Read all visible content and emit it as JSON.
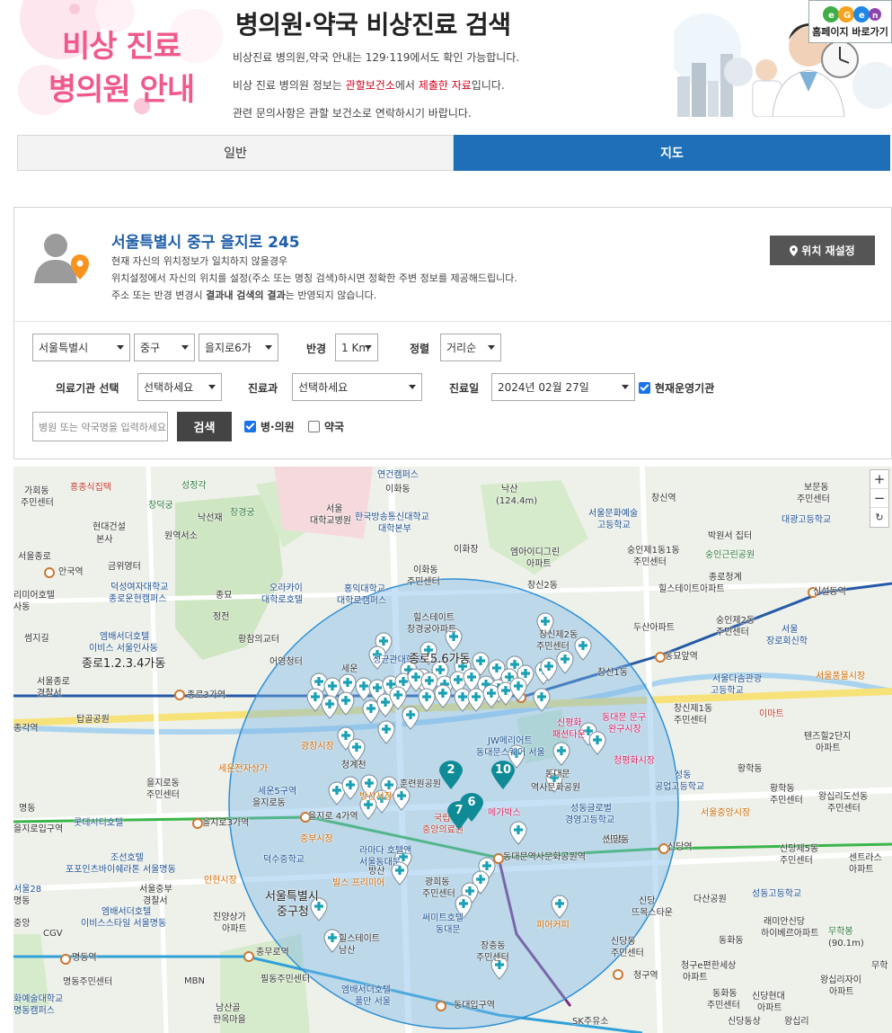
{
  "header": {
    "hero_line1": "비상 진료",
    "hero_line2": "병의원 안내",
    "title": "병의원·약국 비상진료 검색",
    "desc1": "비상진료 병의원,약국 안내는 129·119에서도 확인 가능합니다.",
    "desc2_pre": "비상 진료 병의원 정보는 ",
    "desc2_red1": "관할보건소",
    "desc2_mid": "에서 ",
    "desc2_red2": "제출한 자료",
    "desc2_post": "입니다.",
    "desc3": "관련 문의사항은 관할 보건소로 연락하시기 바랍니다.",
    "home_button": "홈페이지 바로가기"
  },
  "tabs": [
    {
      "label": "일반",
      "active": false
    },
    {
      "label": "지도",
      "active": true
    }
  ],
  "location": {
    "address": "서울특별시 중구 을지로 245",
    "note1": "현재 자신의 위치정보가 일치하지 않을경우",
    "note2": "위치설정에서 자신의 위치를 설정(주소 또는 명칭 검색)하시면 정확한 주변 정보를 제공해드립니다.",
    "note3_pre": "주소 또는 반경 변경시 ",
    "note3_bold": "결과내 검색의 결과",
    "note3_post": "는 반영되지 않습니다.",
    "reset_button": "위치 재설정"
  },
  "filters": {
    "city": "서울특별시",
    "district": "중구",
    "dong": "을지로6가",
    "radius_label": "반경",
    "radius": "1 Km",
    "sort_label": "정렬",
    "sort": "거리순",
    "org_label": "의료기관 선택",
    "org": "선택하세요",
    "dept_label": "진료과",
    "dept": "선택하세요",
    "date_label": "진료일",
    "date": "2024년 02월 27일",
    "open_now_label": "현재운영기관",
    "open_now_checked": true,
    "search_placeholder": "병원 또는 약국명을 입력하세요",
    "search_button": "검색",
    "hospital_label": "병·의원",
    "hospital_checked": true,
    "pharmacy_label": "약국",
    "pharmacy_checked": false
  },
  "map": {
    "zoom_in": "+",
    "zoom_out": "−",
    "reset": "↻",
    "labels": {
      "l1": "가회동",
      "l2": "주민센터",
      "l3": "홍종식집택",
      "l4": "창덕궁",
      "l5": "성정각",
      "l6": "낙선재",
      "l7": "창경궁",
      "l8": "현대건설",
      "l9": "본사",
      "l10": "원역서소",
      "l11": "금위영터",
      "l12": "안국역",
      "l13": "덕성여자대학교",
      "l14": "종로운현캠퍼스",
      "l15": "리미어호텔",
      "l16": "사동",
      "l17": "썸지길",
      "l18": "종묘",
      "l19": "정전",
      "l20": "오라카이",
      "l21": "대학로호텔",
      "l22": "엠배서더호텔",
      "l23": "이비스 서울인사동",
      "l24": "종로1.2.3.4가동",
      "l25": "서울종로",
      "l26": "경찰서",
      "l27": "종로3가역",
      "l28": "탑골공원",
      "l29": "종각역",
      "l30": "황참의교터",
      "l31": "어영청터",
      "l32": "연건캠퍼스",
      "l33": "이화동",
      "l34": "서울",
      "l35": "대학교병원",
      "l36": "한국방송통신대학교",
      "l37": "대학본부",
      "l38": "낙산",
      "l39": "(124.4m)",
      "l40": "창신역",
      "l41": "서울문화예술",
      "l42": "고등학교",
      "l43": "숭인제1동1동",
      "l44": "주민센터",
      "l45": "엠아이디그린",
      "l46": "아파트",
      "l47": "이화장",
      "l48": "이화동",
      "l49": "주민센터",
      "l50": "홍익대학교",
      "l51": "대학로캠퍼스",
      "l52": "창신2동",
      "l53": "힐스테이트",
      "l54": "창경궁아파트",
      "l55": "창신제2동",
      "l56": "주민센터",
      "l57": "두산아파트",
      "l58": "종로청계",
      "l59": "힐스테이트아파트",
      "l60": "숭인제2동",
      "l61": "주민센터",
      "l62": "박원서 집터",
      "l63": "숭인근린공원",
      "l64": "신설동역",
      "l65": "대광고등학교",
      "l66": "보문동",
      "l67": "주민센터",
      "l68": "서울",
      "l69": "장로회신학",
      "l70": "동묘앞역",
      "l71": "창신1동",
      "l72": "서울다솜관광",
      "l73": "고등학교",
      "l74": "서울풍물시장",
      "l75": "이마트",
      "l76": "창신제1동",
      "l77": "주민센터",
      "l78": "텐즈힐2단지",
      "l79": "아파트",
      "l80": "동대문 문구",
      "l81": "완구시장",
      "l82": "신평화",
      "l83": "패션타운",
      "l84": "청평화시장",
      "l85": "JW메리어트",
      "l86": "동대문스퀘어 서울",
      "l87": "황학동",
      "l88": "성동",
      "l89": "공업고등학교",
      "l90": "황학동",
      "l91": "주민센터",
      "l92": "왕십리도선동",
      "l93": "주민센터",
      "l94": "광장시장",
      "l95": "세운전자상가",
      "l96": "방산시장",
      "l97": "서울중앙시장",
      "l98": "청계천",
      "l99": "세운5구역",
      "l100": "을지로동",
      "l101": "을지로 4가역",
      "l102": "을지로3가역",
      "l103": "롯데시티호텔",
      "l104": "명동",
      "l105": "을지로동",
      "l106": "주민센터",
      "l107": "조선호텔",
      "l108": "포포인츠바이쉐라톤 서울명동",
      "l109": "동대문역사문화공원역",
      "l110": "신당동",
      "l111": "신당역",
      "l112": "신당제5동",
      "l113": "주민센터",
      "l114": "센트라스",
      "l115": "아파트",
      "l116": "동대문",
      "l117": "역사문화공원",
      "l118": "성동글로벌",
      "l119": "경영고등학교",
      "l120": "신당동",
      "l121": "중부시장",
      "l122": "덕수중학교",
      "l123": "라마다 호텔앤",
      "l124": "서울동대문",
      "l125": "인현시장",
      "l126": "빌스 프리미어",
      "l127": "광희동",
      "l128": "주민센터",
      "l129": "서울중부",
      "l130": "경찰서",
      "l131": "엠배서더호텔",
      "l132": "이비스스타일 서울명동",
      "l133": "서울특별시",
      "l134": "중구청",
      "l135": "진양상가",
      "l136": "아파트",
      "l137": "충무로역",
      "l138": "명동역",
      "l139": "힐스테이트",
      "l140": "남산",
      "l141": "써미트호텔",
      "l142": "동대문",
      "l143": "장충동",
      "l144": "주민센터",
      "l145": "신당",
      "l146": "뜨목스타운",
      "l147": "다산공원",
      "l148": "성동고등학교",
      "l149": "래미안신당",
      "l150": "하이베르아파트",
      "l151": "무학봉",
      "l152": "(90.1m)",
      "l153": "동화동",
      "l154": "신당동",
      "l155": "주민센터",
      "l156": "필동주민센터",
      "l157": "MBN",
      "l158": "명동주민센터",
      "l159": "화예술대학교",
      "l160": "명동캠퍼스",
      "l161": "엠배서더호텔",
      "l162": "풀만 서울",
      "l163": "동대입구역",
      "l164": "SK주유소",
      "l165": "청구역",
      "l166": "청구e편한세상",
      "l167": "아파트",
      "l168": "동화동",
      "l169": "주민센터",
      "l170": "신당현대",
      "l171": "아파트",
      "l172": "왕십리자이",
      "l173": "아파트",
      "l174": "남산골",
      "l175": "한옥마을",
      "l176": "CGV",
      "l177": "피어커피",
      "l178": "메가박스",
      "l179": "신당동상",
      "l180": "왕십리",
      "l181": "훈련원공원",
      "l182": "국립",
      "l183": "중앙의료원",
      "l184": "서울종로",
      "l185": "세운",
      "l186": "성균관대학교",
      "l187": "서울28",
      "l188": "명동",
      "l189": "종로5.6가동",
      "l190": "방산",
      "l191": "을지로입구역",
      "l192": "중앙",
      "l193": "무학"
    },
    "clusters": [
      {
        "label": "2"
      },
      {
        "label": "10"
      },
      {
        "label": "6"
      },
      {
        "label": "7"
      }
    ]
  }
}
